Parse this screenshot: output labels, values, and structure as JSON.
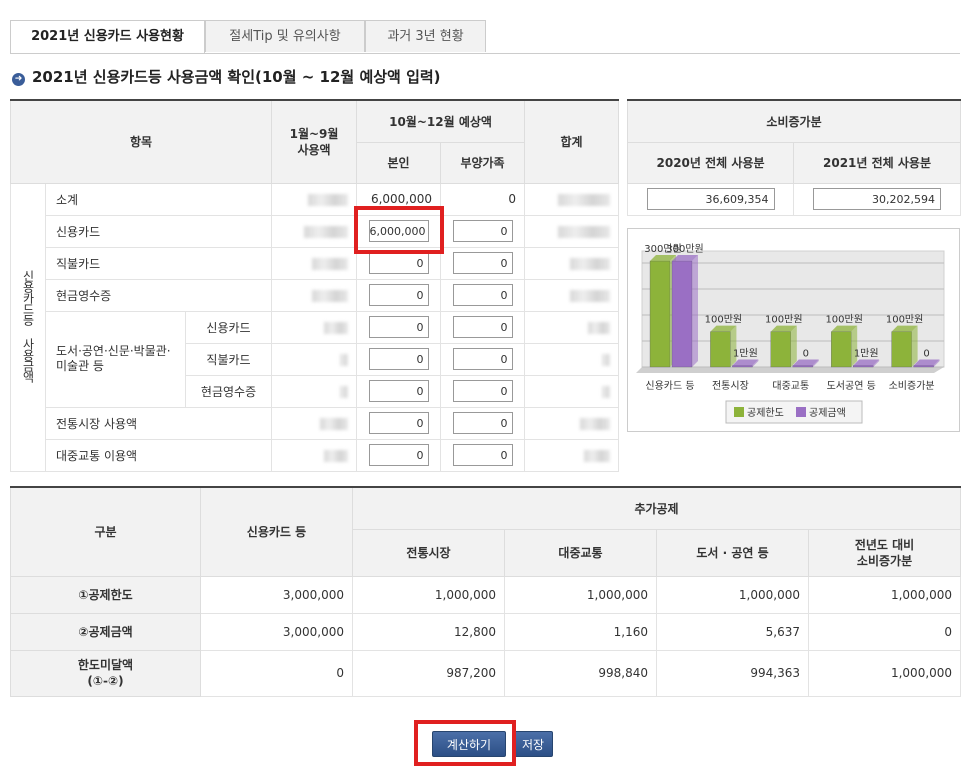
{
  "tabs": [
    "2021년 신용카드 사용현황",
    "절세Tip 및 유의사항",
    "과거 3년 현황"
  ],
  "heading": "2021년 신용카드등 사용금액 확인(10월 ~ 12월 예상액 입력)",
  "usage_table": {
    "col_item": "항목",
    "col_jan_sep": "1월~9월\n사용액",
    "col_oct_dec": "10월~12월 예상액",
    "col_self": "본인",
    "col_dependent": "부양가족",
    "col_total": "합계",
    "group_label": "신용카드등 사용금액",
    "sub_group_label": "도서·공연·신문·박물관·미술관 등",
    "rows": [
      {
        "label": "소계",
        "self": "6,000,000",
        "dependent": "0"
      },
      {
        "label": "신용카드",
        "self": "6,000,000",
        "dependent": "0"
      },
      {
        "label": "직불카드",
        "self": "0",
        "dependent": "0"
      },
      {
        "label": "현금영수증",
        "self": "0",
        "dependent": "0"
      },
      {
        "label": "신용카드",
        "self": "0",
        "dependent": "0"
      },
      {
        "label": "직불카드",
        "self": "0",
        "dependent": "0"
      },
      {
        "label": "현금영수증",
        "self": "0",
        "dependent": "0"
      },
      {
        "label": "전통시장 사용액",
        "self": "0",
        "dependent": "0"
      },
      {
        "label": "대중교통 이용액",
        "self": "0",
        "dependent": "0"
      }
    ]
  },
  "consumption": {
    "title": "소비증가분",
    "col_2020": "2020년 전체 사용분",
    "col_2021": "2021년 전체 사용분",
    "val_2020": "36,609,354",
    "val_2021": "30,202,594"
  },
  "chart_data": {
    "type": "bar",
    "categories": [
      "신용카드 등",
      "전통시장",
      "대중교통",
      "도서공연 등",
      "소비증가분"
    ],
    "series": [
      {
        "name": "공제한도",
        "values": [
          3000000,
          1000000,
          1000000,
          1000000,
          1000000
        ],
        "color": "#8db33a"
      },
      {
        "name": "공제금액",
        "values": [
          3000000,
          12800,
          1160,
          5637,
          0
        ],
        "color": "#9a6fc4"
      }
    ],
    "data_labels": {
      "limit": [
        "300만원",
        "100만원",
        "100만원",
        "100만원",
        "100만원"
      ],
      "amount": [
        "300만원",
        "1만원",
        "0",
        "1만원",
        "0"
      ]
    },
    "legend_position": "bottom"
  },
  "deduction_table": {
    "col_category": "구분",
    "col_credit": "신용카드 등",
    "col_additional": "추가공제",
    "col_market": "전통시장",
    "col_transit": "대중교통",
    "col_culture": "도서 · 공연 등",
    "col_increase": "전년도 대비\n소비증가분",
    "rows": [
      {
        "label": "①공제한도",
        "values": [
          "3,000,000",
          "1,000,000",
          "1,000,000",
          "1,000,000",
          "1,000,000"
        ]
      },
      {
        "label": "②공제금액",
        "values": [
          "3,000,000",
          "12,800",
          "1,160",
          "5,637",
          "0"
        ]
      },
      {
        "label": "한도미달액\n(①-②)",
        "values": [
          "0",
          "987,200",
          "998,840",
          "994,363",
          "1,000,000"
        ]
      }
    ]
  },
  "buttons": {
    "calculate": "계산하기",
    "save": "저장"
  }
}
